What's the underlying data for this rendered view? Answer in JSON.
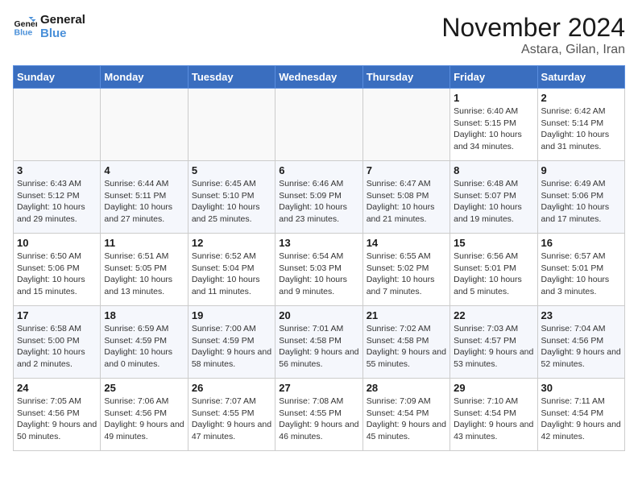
{
  "header": {
    "logo_line1": "General",
    "logo_line2": "Blue",
    "month_year": "November 2024",
    "location": "Astara, Gilan, Iran"
  },
  "days_of_week": [
    "Sunday",
    "Monday",
    "Tuesday",
    "Wednesday",
    "Thursday",
    "Friday",
    "Saturday"
  ],
  "weeks": [
    [
      {
        "day": "",
        "content": ""
      },
      {
        "day": "",
        "content": ""
      },
      {
        "day": "",
        "content": ""
      },
      {
        "day": "",
        "content": ""
      },
      {
        "day": "",
        "content": ""
      },
      {
        "day": "1",
        "content": "Sunrise: 6:40 AM\nSunset: 5:15 PM\nDaylight: 10 hours and 34 minutes."
      },
      {
        "day": "2",
        "content": "Sunrise: 6:42 AM\nSunset: 5:14 PM\nDaylight: 10 hours and 31 minutes."
      }
    ],
    [
      {
        "day": "3",
        "content": "Sunrise: 6:43 AM\nSunset: 5:12 PM\nDaylight: 10 hours and 29 minutes."
      },
      {
        "day": "4",
        "content": "Sunrise: 6:44 AM\nSunset: 5:11 PM\nDaylight: 10 hours and 27 minutes."
      },
      {
        "day": "5",
        "content": "Sunrise: 6:45 AM\nSunset: 5:10 PM\nDaylight: 10 hours and 25 minutes."
      },
      {
        "day": "6",
        "content": "Sunrise: 6:46 AM\nSunset: 5:09 PM\nDaylight: 10 hours and 23 minutes."
      },
      {
        "day": "7",
        "content": "Sunrise: 6:47 AM\nSunset: 5:08 PM\nDaylight: 10 hours and 21 minutes."
      },
      {
        "day": "8",
        "content": "Sunrise: 6:48 AM\nSunset: 5:07 PM\nDaylight: 10 hours and 19 minutes."
      },
      {
        "day": "9",
        "content": "Sunrise: 6:49 AM\nSunset: 5:06 PM\nDaylight: 10 hours and 17 minutes."
      }
    ],
    [
      {
        "day": "10",
        "content": "Sunrise: 6:50 AM\nSunset: 5:06 PM\nDaylight: 10 hours and 15 minutes."
      },
      {
        "day": "11",
        "content": "Sunrise: 6:51 AM\nSunset: 5:05 PM\nDaylight: 10 hours and 13 minutes."
      },
      {
        "day": "12",
        "content": "Sunrise: 6:52 AM\nSunset: 5:04 PM\nDaylight: 10 hours and 11 minutes."
      },
      {
        "day": "13",
        "content": "Sunrise: 6:54 AM\nSunset: 5:03 PM\nDaylight: 10 hours and 9 minutes."
      },
      {
        "day": "14",
        "content": "Sunrise: 6:55 AM\nSunset: 5:02 PM\nDaylight: 10 hours and 7 minutes."
      },
      {
        "day": "15",
        "content": "Sunrise: 6:56 AM\nSunset: 5:01 PM\nDaylight: 10 hours and 5 minutes."
      },
      {
        "day": "16",
        "content": "Sunrise: 6:57 AM\nSunset: 5:01 PM\nDaylight: 10 hours and 3 minutes."
      }
    ],
    [
      {
        "day": "17",
        "content": "Sunrise: 6:58 AM\nSunset: 5:00 PM\nDaylight: 10 hours and 2 minutes."
      },
      {
        "day": "18",
        "content": "Sunrise: 6:59 AM\nSunset: 4:59 PM\nDaylight: 10 hours and 0 minutes."
      },
      {
        "day": "19",
        "content": "Sunrise: 7:00 AM\nSunset: 4:59 PM\nDaylight: 9 hours and 58 minutes."
      },
      {
        "day": "20",
        "content": "Sunrise: 7:01 AM\nSunset: 4:58 PM\nDaylight: 9 hours and 56 minutes."
      },
      {
        "day": "21",
        "content": "Sunrise: 7:02 AM\nSunset: 4:58 PM\nDaylight: 9 hours and 55 minutes."
      },
      {
        "day": "22",
        "content": "Sunrise: 7:03 AM\nSunset: 4:57 PM\nDaylight: 9 hours and 53 minutes."
      },
      {
        "day": "23",
        "content": "Sunrise: 7:04 AM\nSunset: 4:56 PM\nDaylight: 9 hours and 52 minutes."
      }
    ],
    [
      {
        "day": "24",
        "content": "Sunrise: 7:05 AM\nSunset: 4:56 PM\nDaylight: 9 hours and 50 minutes."
      },
      {
        "day": "25",
        "content": "Sunrise: 7:06 AM\nSunset: 4:56 PM\nDaylight: 9 hours and 49 minutes."
      },
      {
        "day": "26",
        "content": "Sunrise: 7:07 AM\nSunset: 4:55 PM\nDaylight: 9 hours and 47 minutes."
      },
      {
        "day": "27",
        "content": "Sunrise: 7:08 AM\nSunset: 4:55 PM\nDaylight: 9 hours and 46 minutes."
      },
      {
        "day": "28",
        "content": "Sunrise: 7:09 AM\nSunset: 4:54 PM\nDaylight: 9 hours and 45 minutes."
      },
      {
        "day": "29",
        "content": "Sunrise: 7:10 AM\nSunset: 4:54 PM\nDaylight: 9 hours and 43 minutes."
      },
      {
        "day": "30",
        "content": "Sunrise: 7:11 AM\nSunset: 4:54 PM\nDaylight: 9 hours and 42 minutes."
      }
    ]
  ]
}
